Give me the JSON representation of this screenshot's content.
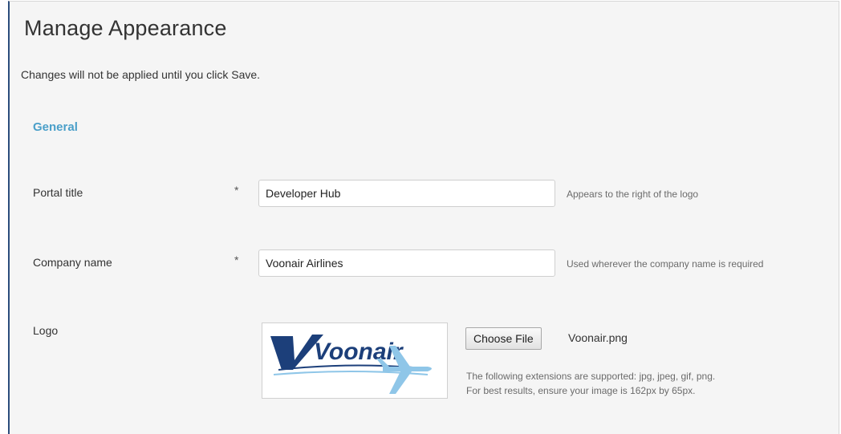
{
  "page": {
    "title": "Manage Appearance",
    "notice": "Changes will not be applied until you click Save."
  },
  "general": {
    "heading": "General",
    "portal_title": {
      "label": "Portal title",
      "required_mark": "*",
      "value": "Developer Hub",
      "help": "Appears to the right of the logo"
    },
    "company_name": {
      "label": "Company name",
      "required_mark": "*",
      "value": "Voonair Airlines",
      "help": "Used wherever the company name is required"
    },
    "logo": {
      "label": "Logo",
      "preview_text": "Voonair",
      "choose_button": "Choose File",
      "file_name": "Voonair.png",
      "extensions_note": "The following extensions are supported: jpg, jpeg, gif, png.",
      "size_note": "For best results, ensure your image is 162px by 65px."
    }
  },
  "colors": {
    "heading": "#4a9fc9",
    "logo_blue": "#1c3f7a",
    "plane_blue": "#8fc6e8",
    "panel_bg": "#f5f5f5"
  }
}
